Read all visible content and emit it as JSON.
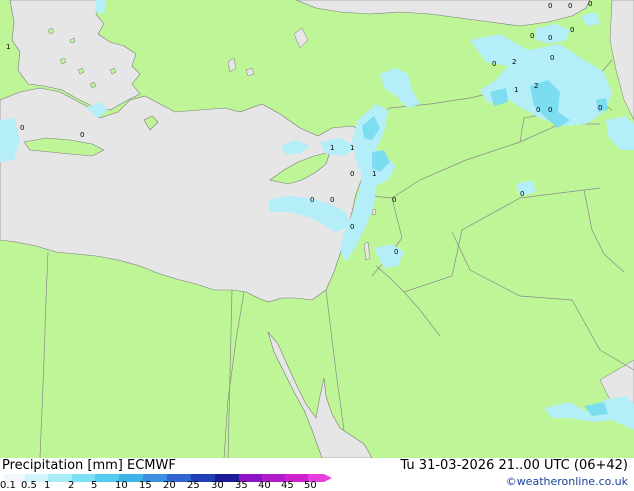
{
  "header": {
    "title": "Precipitation [mm]  ECMWF",
    "valid_time": "Tu 31-03-2026 21..00 UTC (06+42)",
    "credit": "©weatheronline.co.uk"
  },
  "legend": {
    "ticks": [
      "0.1",
      "0.5",
      "1",
      "2",
      "5",
      "10",
      "15",
      "20",
      "25",
      "30",
      "35",
      "40",
      "45",
      "50"
    ],
    "colors": [
      "#f0f8ff",
      "#d0f4fa",
      "#a8ecf6",
      "#7ee0f4",
      "#54ccee",
      "#3cb4e8",
      "#3c8ee0",
      "#3066d0",
      "#2040b8",
      "#1a1a9a",
      "#8c14c4",
      "#b01ccc",
      "#d020d0",
      "#e840e0"
    ]
  },
  "map": {
    "colors": {
      "land": "#bef596",
      "sea": "#e6e6e6",
      "border": "#8a8a8a",
      "coast": "#7a7a7a",
      "rain_light": "#b4eef8",
      "rain_medium": "#7cdcf0",
      "rain_heavy": "#4cc0ea"
    },
    "rain_labels": [
      "1",
      "0",
      "1",
      "1",
      "0",
      "1",
      "0",
      "0",
      "0",
      "0",
      "0",
      "2",
      "1",
      "2",
      "0",
      "0",
      "0",
      "0",
      "0",
      "0",
      "0",
      "0",
      "0",
      "0",
      "0",
      "0",
      "0"
    ]
  }
}
